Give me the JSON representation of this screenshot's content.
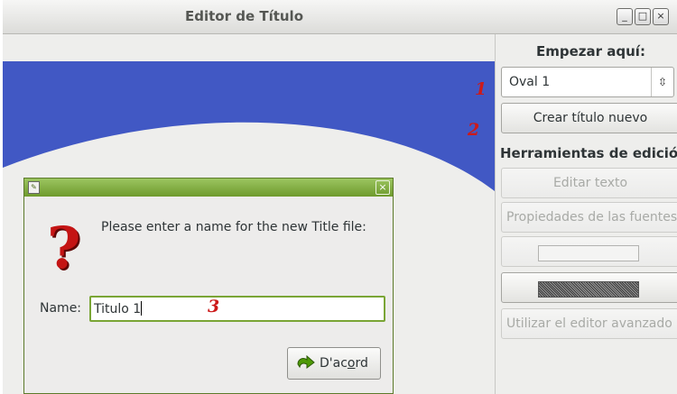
{
  "window": {
    "title": "Editor de Título"
  },
  "panel": {
    "header": "Empezar aquí:",
    "combo_value": "Oval 1",
    "create_button": "Crear título nuevo",
    "tools_header": "Herramientas de edición",
    "edit_text": "Editar texto",
    "font_props": "Propiedades de las fuentes",
    "advanced_editor": "Utilizar el editor avanzado"
  },
  "steps": {
    "one": "1",
    "two": "2",
    "three": "3"
  },
  "dialog": {
    "message": "Please enter a name for the new Title file:",
    "name_label": "Name:",
    "name_value": "Titulo 1",
    "ok_label_pre": "D'ac",
    "ok_label_mnemonic": "o",
    "ok_label_post": "rd"
  },
  "colors": {
    "banner_blue": "#4158c4",
    "dialog_titlebar": "#8ab54b",
    "step_red": "#cc1a1a"
  },
  "icons": {
    "question": "question-mark-icon",
    "ok": "green-check-arrow-icon"
  }
}
